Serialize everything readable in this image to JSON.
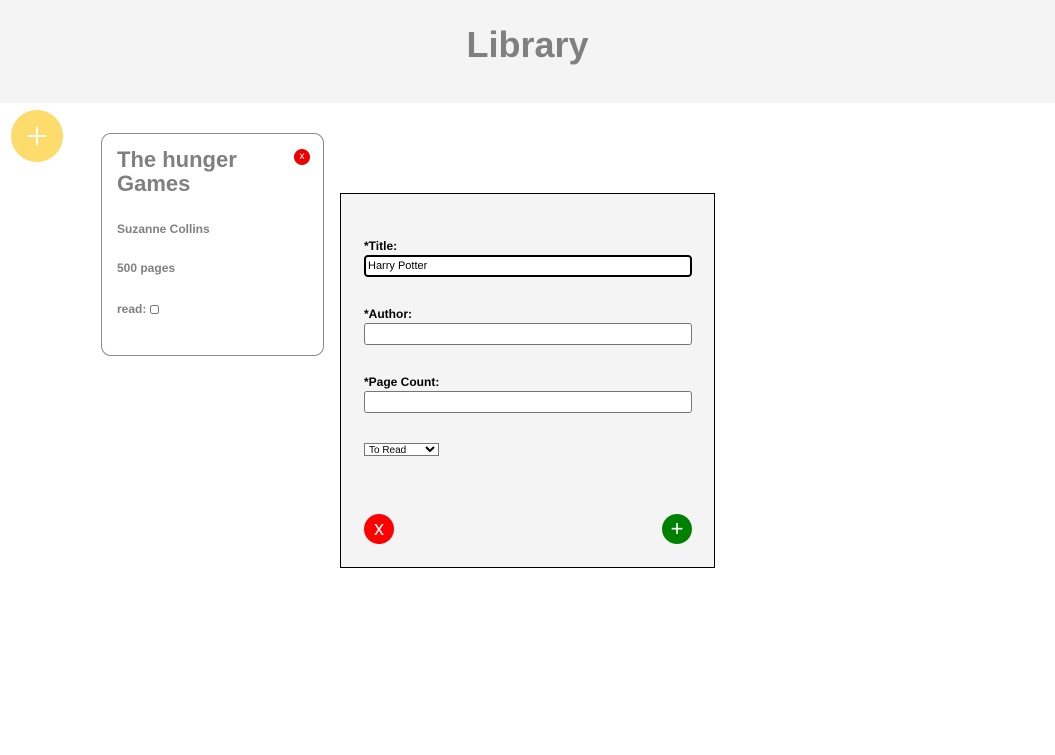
{
  "header": {
    "title": "Library"
  },
  "fab": {
    "icon": "plus-icon",
    "color": "#fddc6c"
  },
  "book_card": {
    "title": "The hunger Games",
    "author": "Suzanne Collins",
    "pages": "500 pages",
    "read_label": "read:",
    "read_checked": false,
    "remove_label": "x",
    "remove_color": "#ee0000"
  },
  "form": {
    "title_label": "*Title:",
    "title_value": "Harry Potter",
    "author_label": "*Author:",
    "author_value": "",
    "pages_label": "*Page Count:",
    "pages_value": "",
    "status_selected": "To Read",
    "cancel_label": "x",
    "cancel_color": "#ff0000",
    "submit_label": "+",
    "submit_color": "#008000"
  }
}
